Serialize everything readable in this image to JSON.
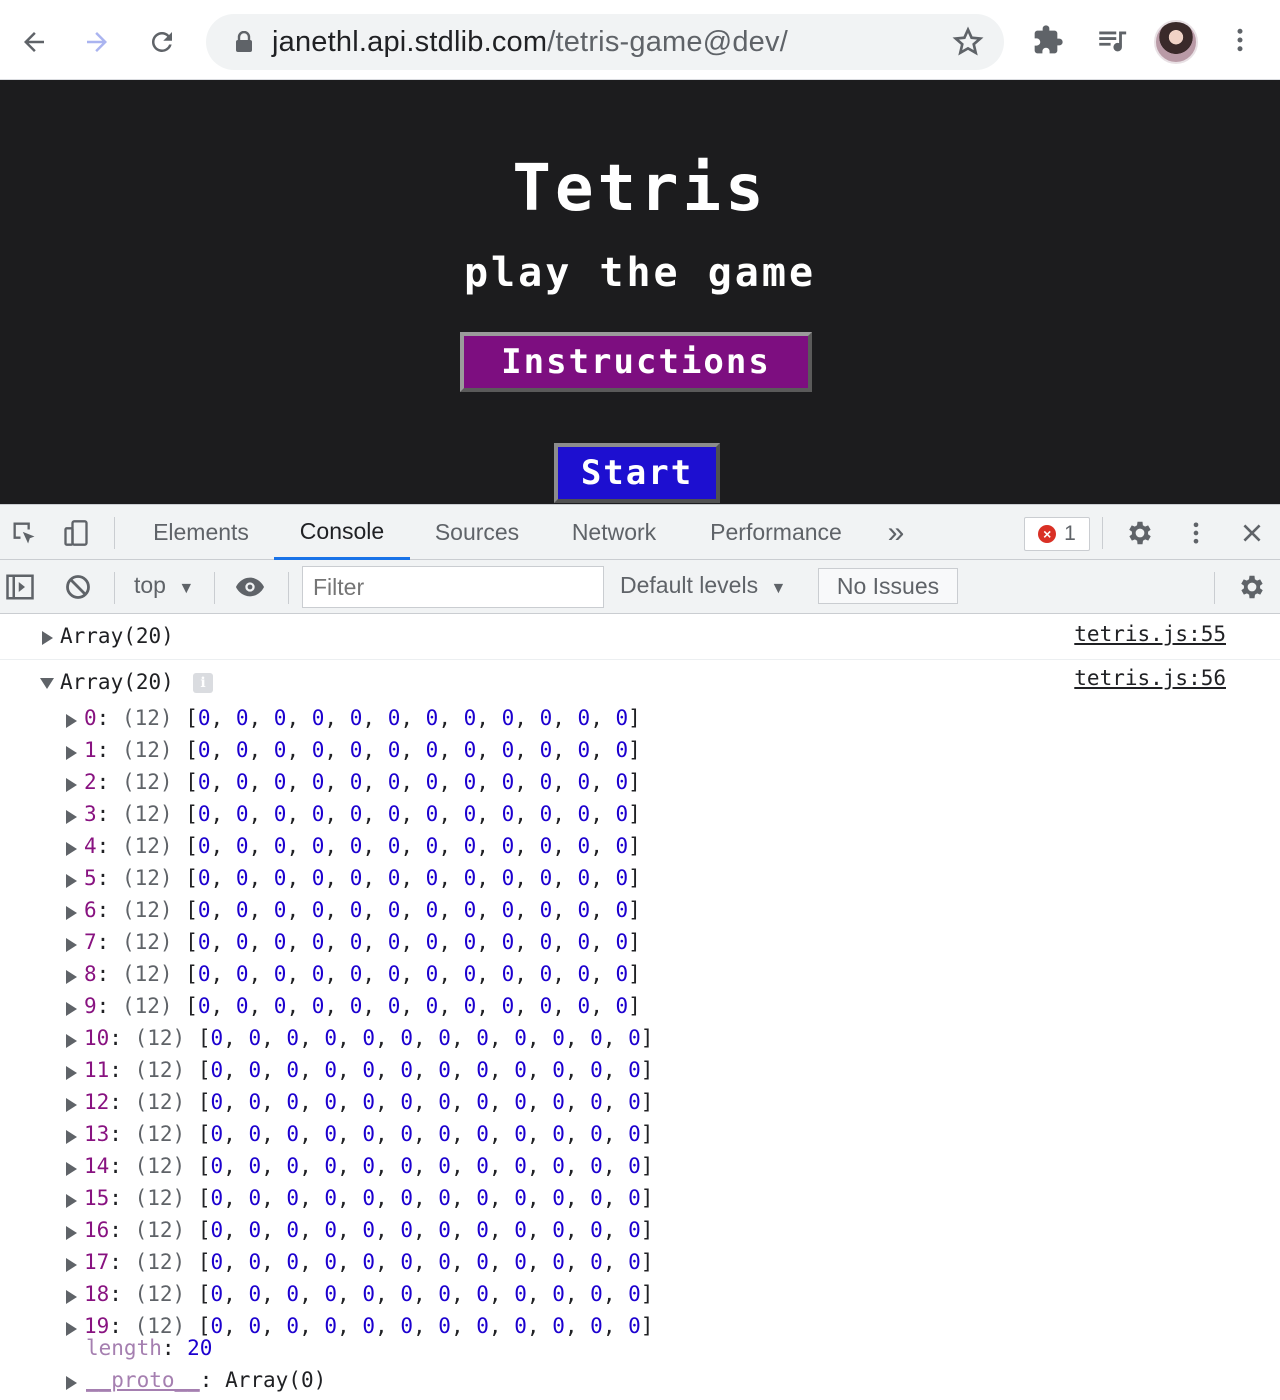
{
  "browser": {
    "url_host": "janethl.api.stdlib.com",
    "url_path": "/tetris-game@dev/"
  },
  "game": {
    "title": "Tetris",
    "subtitle": "play the game",
    "instructions_label": "Instructions",
    "start_label": "Start",
    "colors": {
      "background": "#1c1c1e",
      "instructions": "#7d0e80",
      "start": "#1d0fd0"
    }
  },
  "devtools": {
    "tabs": [
      "Elements",
      "Console",
      "Sources",
      "Network",
      "Performance"
    ],
    "active_tab": "Console",
    "more_tabs_label": "»",
    "error_count": "1",
    "context": "top",
    "filter_placeholder": "Filter",
    "levels": "Default levels",
    "issues": "No Issues"
  },
  "console": {
    "log1": {
      "label": "Array(20)",
      "source": "tetris.js:55"
    },
    "log2": {
      "label": "Array(20)",
      "source": "tetris.js:56",
      "rows": [
        {
          "index": "0",
          "len": "(12)",
          "values": "[0, 0, 0, 0, 0, 0, 0, 0, 0, 0, 0, 0]"
        },
        {
          "index": "1",
          "len": "(12)",
          "values": "[0, 0, 0, 0, 0, 0, 0, 0, 0, 0, 0, 0]"
        },
        {
          "index": "2",
          "len": "(12)",
          "values": "[0, 0, 0, 0, 0, 0, 0, 0, 0, 0, 0, 0]"
        },
        {
          "index": "3",
          "len": "(12)",
          "values": "[0, 0, 0, 0, 0, 0, 0, 0, 0, 0, 0, 0]"
        },
        {
          "index": "4",
          "len": "(12)",
          "values": "[0, 0, 0, 0, 0, 0, 0, 0, 0, 0, 0, 0]"
        },
        {
          "index": "5",
          "len": "(12)",
          "values": "[0, 0, 0, 0, 0, 0, 0, 0, 0, 0, 0, 0]"
        },
        {
          "index": "6",
          "len": "(12)",
          "values": "[0, 0, 0, 0, 0, 0, 0, 0, 0, 0, 0, 0]"
        },
        {
          "index": "7",
          "len": "(12)",
          "values": "[0, 0, 0, 0, 0, 0, 0, 0, 0, 0, 0, 0]"
        },
        {
          "index": "8",
          "len": "(12)",
          "values": "[0, 0, 0, 0, 0, 0, 0, 0, 0, 0, 0, 0]"
        },
        {
          "index": "9",
          "len": "(12)",
          "values": "[0, 0, 0, 0, 0, 0, 0, 0, 0, 0, 0, 0]"
        },
        {
          "index": "10",
          "len": "(12)",
          "values": "[0, 0, 0, 0, 0, 0, 0, 0, 0, 0, 0, 0]"
        },
        {
          "index": "11",
          "len": "(12)",
          "values": "[0, 0, 0, 0, 0, 0, 0, 0, 0, 0, 0, 0]"
        },
        {
          "index": "12",
          "len": "(12)",
          "values": "[0, 0, 0, 0, 0, 0, 0, 0, 0, 0, 0, 0]"
        },
        {
          "index": "13",
          "len": "(12)",
          "values": "[0, 0, 0, 0, 0, 0, 0, 0, 0, 0, 0, 0]"
        },
        {
          "index": "14",
          "len": "(12)",
          "values": "[0, 0, 0, 0, 0, 0, 0, 0, 0, 0, 0, 0]"
        },
        {
          "index": "15",
          "len": "(12)",
          "values": "[0, 0, 0, 0, 0, 0, 0, 0, 0, 0, 0, 0]"
        },
        {
          "index": "16",
          "len": "(12)",
          "values": "[0, 0, 0, 0, 0, 0, 0, 0, 0, 0, 0, 0]"
        },
        {
          "index": "17",
          "len": "(12)",
          "values": "[0, 0, 0, 0, 0, 0, 0, 0, 0, 0, 0, 0]"
        },
        {
          "index": "18",
          "len": "(12)",
          "values": "[0, 0, 0, 0, 0, 0, 0, 0, 0, 0, 0, 0]"
        },
        {
          "index": "19",
          "len": "(12)",
          "values": "[0, 0, 0, 0, 0, 0, 0, 0, 0, 0, 0, 0]"
        }
      ],
      "length_key": "length",
      "length_value": "20",
      "proto_key": "__proto__",
      "proto_value": "Array(0)"
    }
  }
}
